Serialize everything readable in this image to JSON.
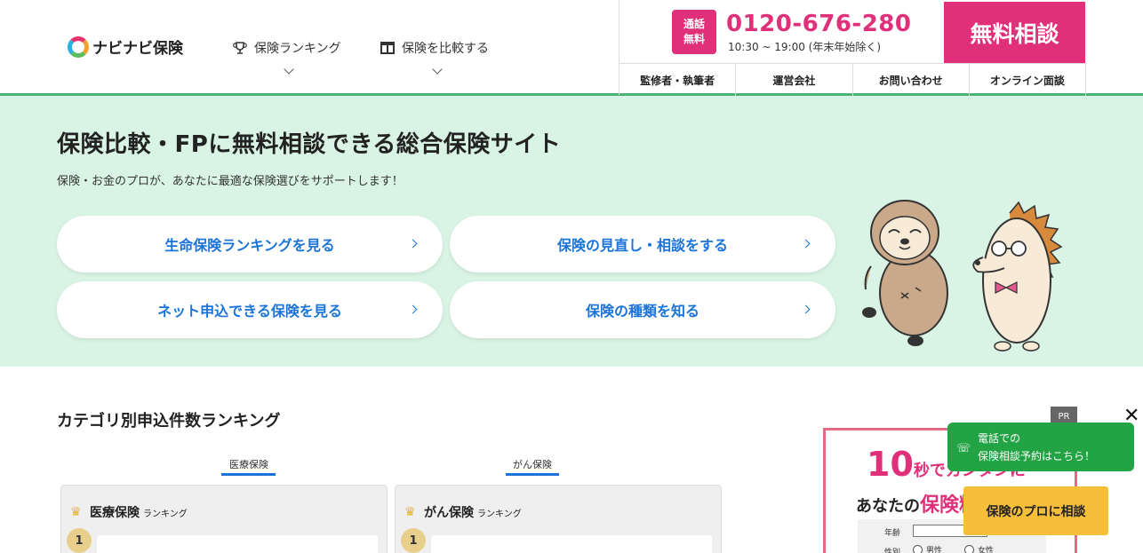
{
  "brand": {
    "logo_text": "ナビナビ保険"
  },
  "nav": {
    "ranking_label": "保険ランキング",
    "compare_label": "保険を比較する"
  },
  "contact": {
    "badge_line1": "通話",
    "badge_line2": "無料",
    "phone": "0120-676-280",
    "hours": "10:30 ~ 19:00 (年末年始除く)",
    "cta": "無料相談",
    "accent_color": "#e0307a"
  },
  "subnav": {
    "items": [
      "監修者・執筆者",
      "運営会社",
      "お問い合わせ",
      "オンライン面談"
    ]
  },
  "hero": {
    "title": "保険比較・FPに無料相談できる総合保険サイト",
    "subtitle": "保険・お金のプロが、あなたに最適な保険選びをサポートします！",
    "buttons": [
      "生命保険ランキングを見る",
      "保険の見直し・相談をする",
      "ネット申込できる保険を見る",
      "保険の種類を知る"
    ],
    "background_color": "#d9f3e5",
    "link_color": "#1a73d9"
  },
  "ranking": {
    "title": "カテゴリ別申込件数ランキング",
    "tabs": [
      "医療保険",
      "がん保険"
    ],
    "cards": [
      {
        "title": "医療保険",
        "suffix": "ランキング",
        "rank": "1"
      },
      {
        "title": "がん保険",
        "suffix": "ランキング",
        "rank": "1"
      }
    ]
  },
  "ad": {
    "pr_label": "PR",
    "close_label": "✕",
    "headline_number": "10",
    "headline_rest": "秒でカンタンに",
    "line2_prefix": "あなたの",
    "line2_highlight": "保険料",
    "age_label": "年齢",
    "gender_label": "性別",
    "male_label": "男性",
    "female_label": "女性"
  },
  "floating": {
    "phone_line1": "電話での",
    "phone_line2": "保険相談予約はこちら！",
    "pro_button": "保険のプロに相談",
    "green": "#22a344",
    "yellow": "#f6be39"
  }
}
